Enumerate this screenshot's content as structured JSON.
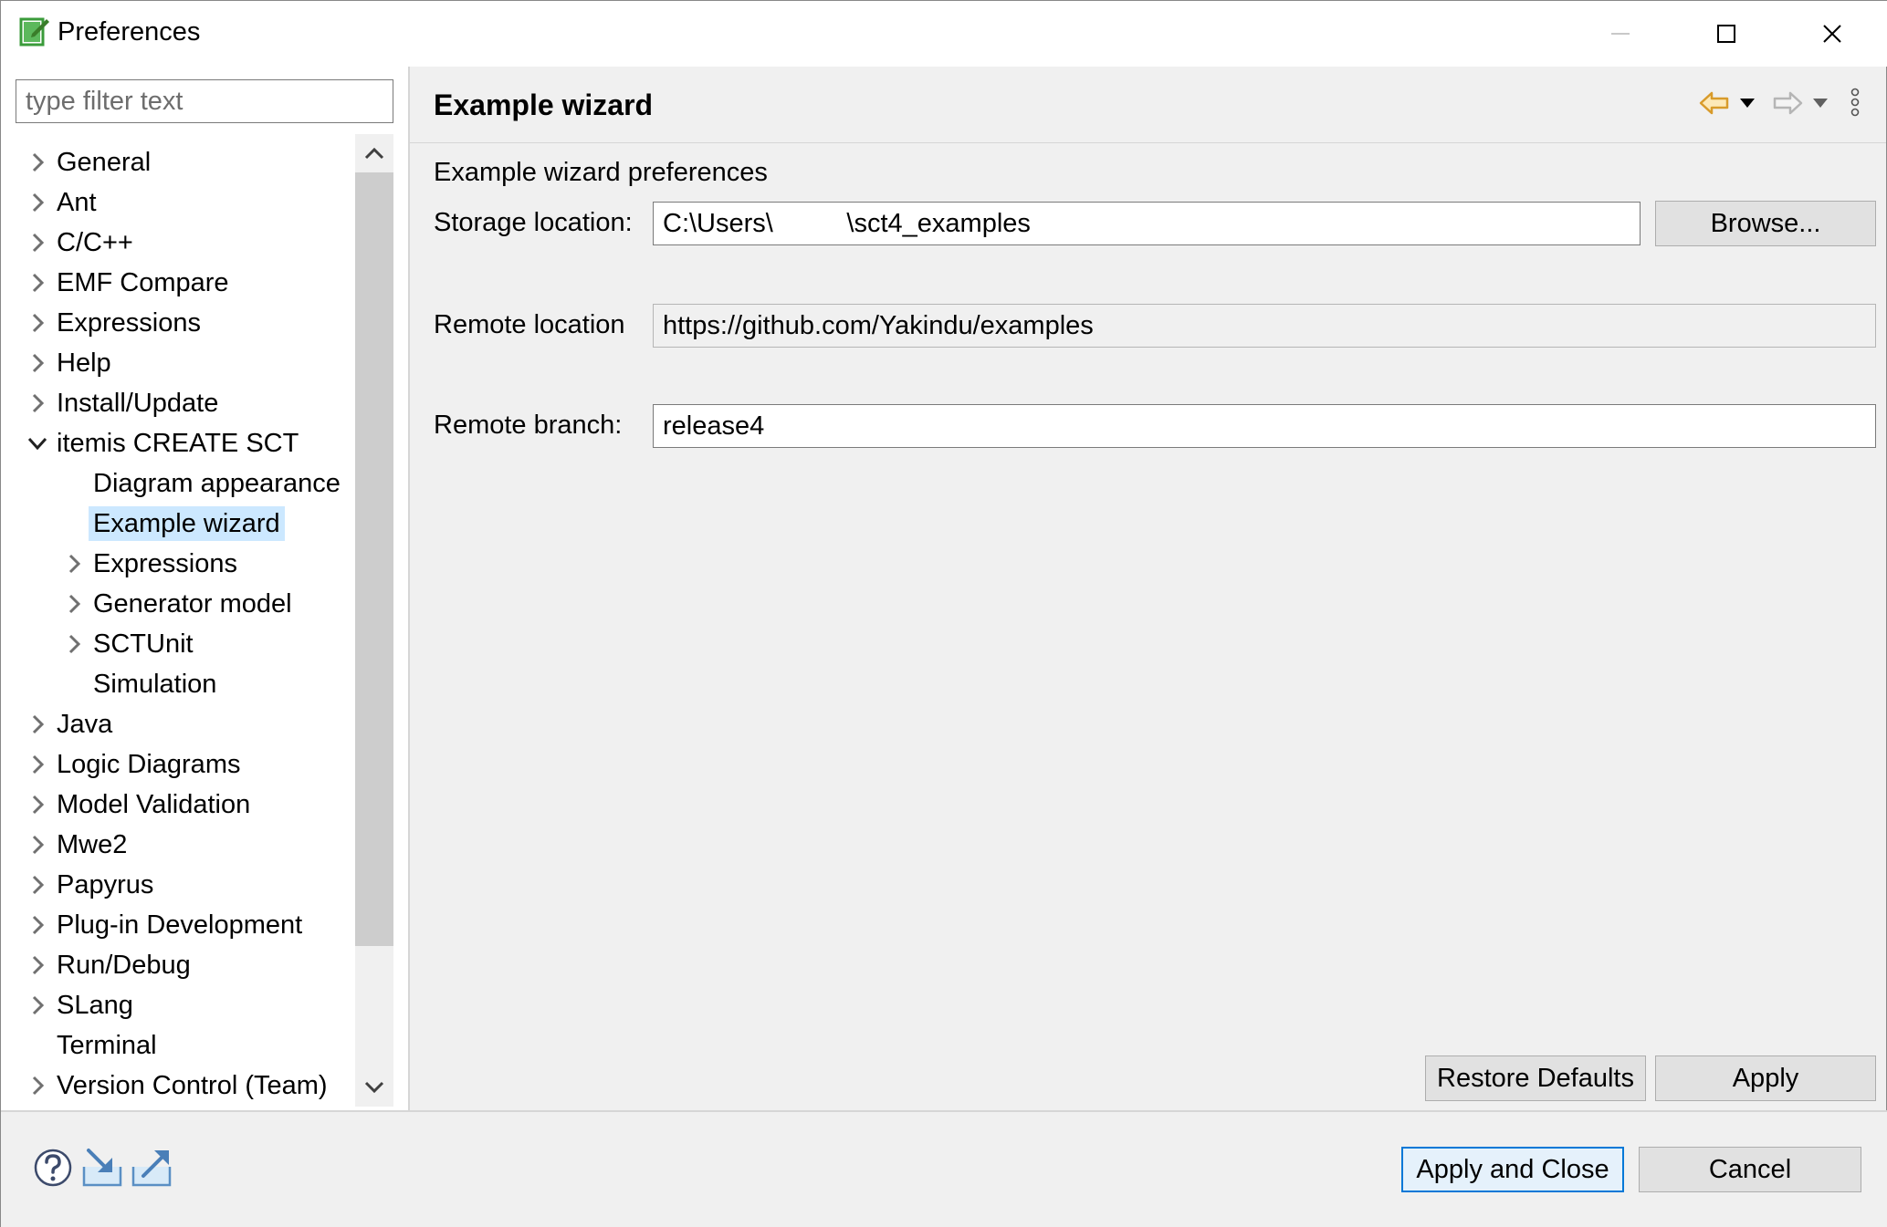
{
  "window": {
    "title": "Preferences"
  },
  "filter": {
    "placeholder": "type filter text"
  },
  "tree": {
    "items": [
      {
        "label": "General",
        "level": 0,
        "expander": "collapsed"
      },
      {
        "label": "Ant",
        "level": 0,
        "expander": "collapsed"
      },
      {
        "label": "C/C++",
        "level": 0,
        "expander": "collapsed"
      },
      {
        "label": "EMF Compare",
        "level": 0,
        "expander": "collapsed"
      },
      {
        "label": "Expressions",
        "level": 0,
        "expander": "collapsed"
      },
      {
        "label": "Help",
        "level": 0,
        "expander": "collapsed"
      },
      {
        "label": "Install/Update",
        "level": 0,
        "expander": "collapsed"
      },
      {
        "label": "itemis CREATE SCT",
        "level": 0,
        "expander": "expanded"
      },
      {
        "label": "Diagram appearance",
        "level": 1,
        "expander": "none"
      },
      {
        "label": "Example wizard",
        "level": 1,
        "expander": "none",
        "selected": true
      },
      {
        "label": "Expressions",
        "level": 1,
        "expander": "collapsed"
      },
      {
        "label": "Generator model",
        "level": 1,
        "expander": "collapsed"
      },
      {
        "label": "SCTUnit",
        "level": 1,
        "expander": "collapsed"
      },
      {
        "label": "Simulation",
        "level": 1,
        "expander": "none"
      },
      {
        "label": "Java",
        "level": 0,
        "expander": "collapsed"
      },
      {
        "label": "Logic Diagrams",
        "level": 0,
        "expander": "collapsed"
      },
      {
        "label": "Model Validation",
        "level": 0,
        "expander": "collapsed"
      },
      {
        "label": "Mwe2",
        "level": 0,
        "expander": "collapsed"
      },
      {
        "label": "Papyrus",
        "level": 0,
        "expander": "collapsed"
      },
      {
        "label": "Plug-in Development",
        "level": 0,
        "expander": "collapsed"
      },
      {
        "label": "Run/Debug",
        "level": 0,
        "expander": "collapsed"
      },
      {
        "label": "SLang",
        "level": 0,
        "expander": "collapsed"
      },
      {
        "label": "Terminal",
        "level": 0,
        "expander": "none"
      },
      {
        "label": "Version Control (Team)",
        "level": 0,
        "expander": "collapsed"
      }
    ]
  },
  "page": {
    "title": "Example wizard",
    "section": "Example wizard preferences",
    "storage_label": "Storage location:",
    "storage_value": "C:\\Users\\          \\sct4_examples",
    "browse_label": "Browse...",
    "remote_location_label": "Remote location",
    "remote_location_value": "https://github.com/Yakindu/examples",
    "remote_branch_label": "Remote branch:",
    "remote_branch_value": "release4",
    "restore_defaults_label": "Restore Defaults",
    "apply_label": "Apply"
  },
  "footer": {
    "apply_close_label": "Apply and Close",
    "cancel_label": "Cancel"
  },
  "colors": {
    "selection": "#cce8ff",
    "default_button_border": "#0078d7",
    "nav_back_arrow": "#d89b2b"
  }
}
